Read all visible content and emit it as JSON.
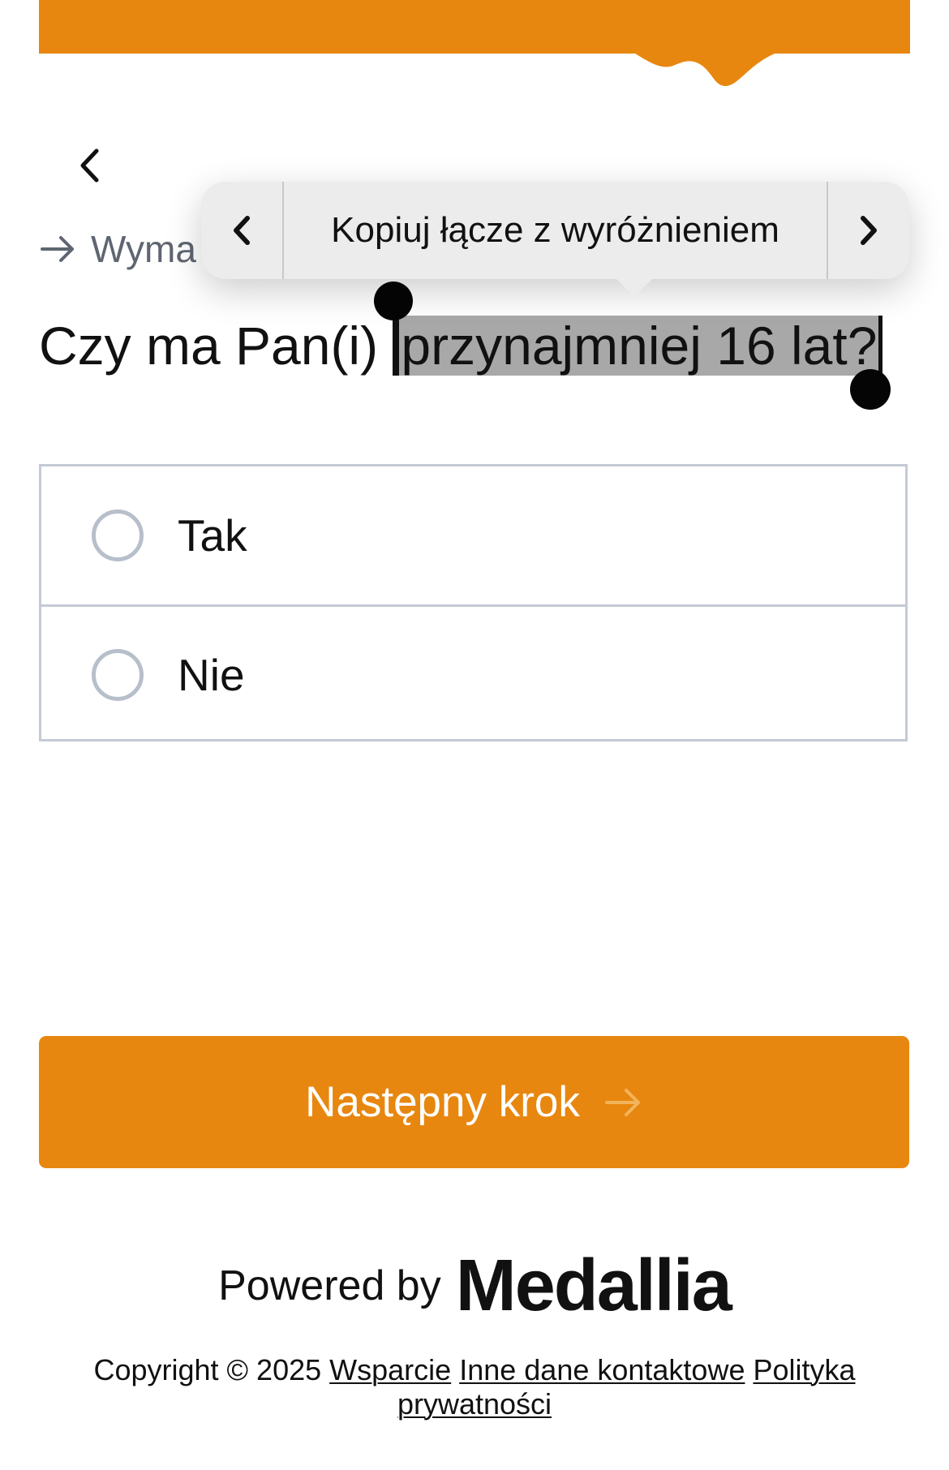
{
  "theme": {
    "accent": "#e8870f",
    "selection": "#a8a8a8",
    "radio_border": "#b7bfcb"
  },
  "header": {
    "back_icon": "chevron-left-icon"
  },
  "required": {
    "text": "Wyma",
    "icon": "arrow-right-icon"
  },
  "question": {
    "prefix": "Czy ma Pan(i) ",
    "selected_text": "przynajmniej 16 lat?"
  },
  "context_menu": {
    "prev_icon": "chevron-left-icon",
    "label": "Kopiuj łącze z wyróżnieniem",
    "next_icon": "chevron-right-icon"
  },
  "options": [
    {
      "label": "Tak",
      "selected": false
    },
    {
      "label": "Nie",
      "selected": false
    }
  ],
  "next_button": {
    "label": "Następny krok",
    "icon": "arrow-right-icon"
  },
  "powered": {
    "prefix": "Powered by",
    "logo_text": "Medallia"
  },
  "footer": {
    "copyright": "Copyright © 2025",
    "links": [
      "Wsparcie",
      "Inne dane kontaktowe",
      "Polityka prywatności"
    ]
  }
}
